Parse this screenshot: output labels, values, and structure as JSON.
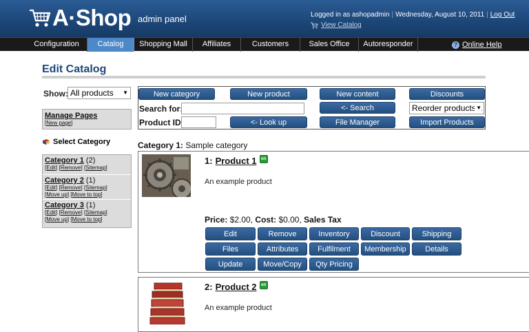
{
  "header": {
    "logo": "A·Shop",
    "subtitle": "admin panel",
    "logged_in": "Logged in as ashopadmin",
    "date": "Wednesday, August 10, 2011",
    "logout": "Log Out",
    "view_catalog": "View Catalog"
  },
  "nav": {
    "tabs": [
      {
        "label": "Configuration"
      },
      {
        "label": "Catalog",
        "active": true
      },
      {
        "label": "Shopping Mall"
      },
      {
        "label": "Affiliates"
      },
      {
        "label": "Customers"
      },
      {
        "label": "Sales Office"
      },
      {
        "label": "Autoresponder"
      }
    ],
    "help": "Online Help"
  },
  "page": {
    "title": "Edit Catalog"
  },
  "filter": {
    "label": "Show:",
    "value": "All products"
  },
  "manage_pages": {
    "title": "Manage Pages",
    "link": "New page"
  },
  "select_category": "Select Category",
  "categories": [
    {
      "name": "Category 1",
      "count": "(2)",
      "links": [
        "Edit",
        "Remove",
        "Sitemap"
      ]
    },
    {
      "name": "Category 2",
      "count": "(1)",
      "links": [
        "Edit",
        "Remove",
        "Sitemap",
        "Move up",
        "Move to top"
      ]
    },
    {
      "name": "Category 3",
      "count": "(1)",
      "links": [
        "Edit",
        "Remove",
        "Sitemap",
        "Move up",
        "Move to top"
      ]
    }
  ],
  "tools": {
    "new_category": "New category",
    "new_product": "New product",
    "new_content": "New content",
    "discounts": "Discounts",
    "search_label": "Search for:",
    "search_btn": "<- Search",
    "reorder": "Reorder products...",
    "product_id_label": "Product ID:",
    "lookup_btn": "<- Look up",
    "file_manager": "File Manager",
    "import_products": "Import Products"
  },
  "category_heading": {
    "label": "Category 1:",
    "value": "Sample category"
  },
  "products": [
    {
      "num": "1:",
      "name": "Product 1",
      "desc": "An example product",
      "price_label": "Price:",
      "price": "$2.00,",
      "cost_label": "Cost:",
      "cost": "$0.00,",
      "tax": "Sales Tax",
      "actions": [
        "Edit",
        "Remove",
        "Inventory",
        "Discount",
        "Shipping",
        "Files",
        "Attributes",
        "Fulfilment",
        "Membership",
        "Details",
        "Update",
        "Move/Copy",
        "Qty Pricing"
      ]
    },
    {
      "num": "2:",
      "name": "Product 2",
      "desc": "An example product"
    }
  ],
  "colors": {
    "header": "#1c4677",
    "nav": "#1a1a1a",
    "active_tab": "#4d88c8",
    "button": "#2c5b91",
    "title": "#1d4878"
  }
}
